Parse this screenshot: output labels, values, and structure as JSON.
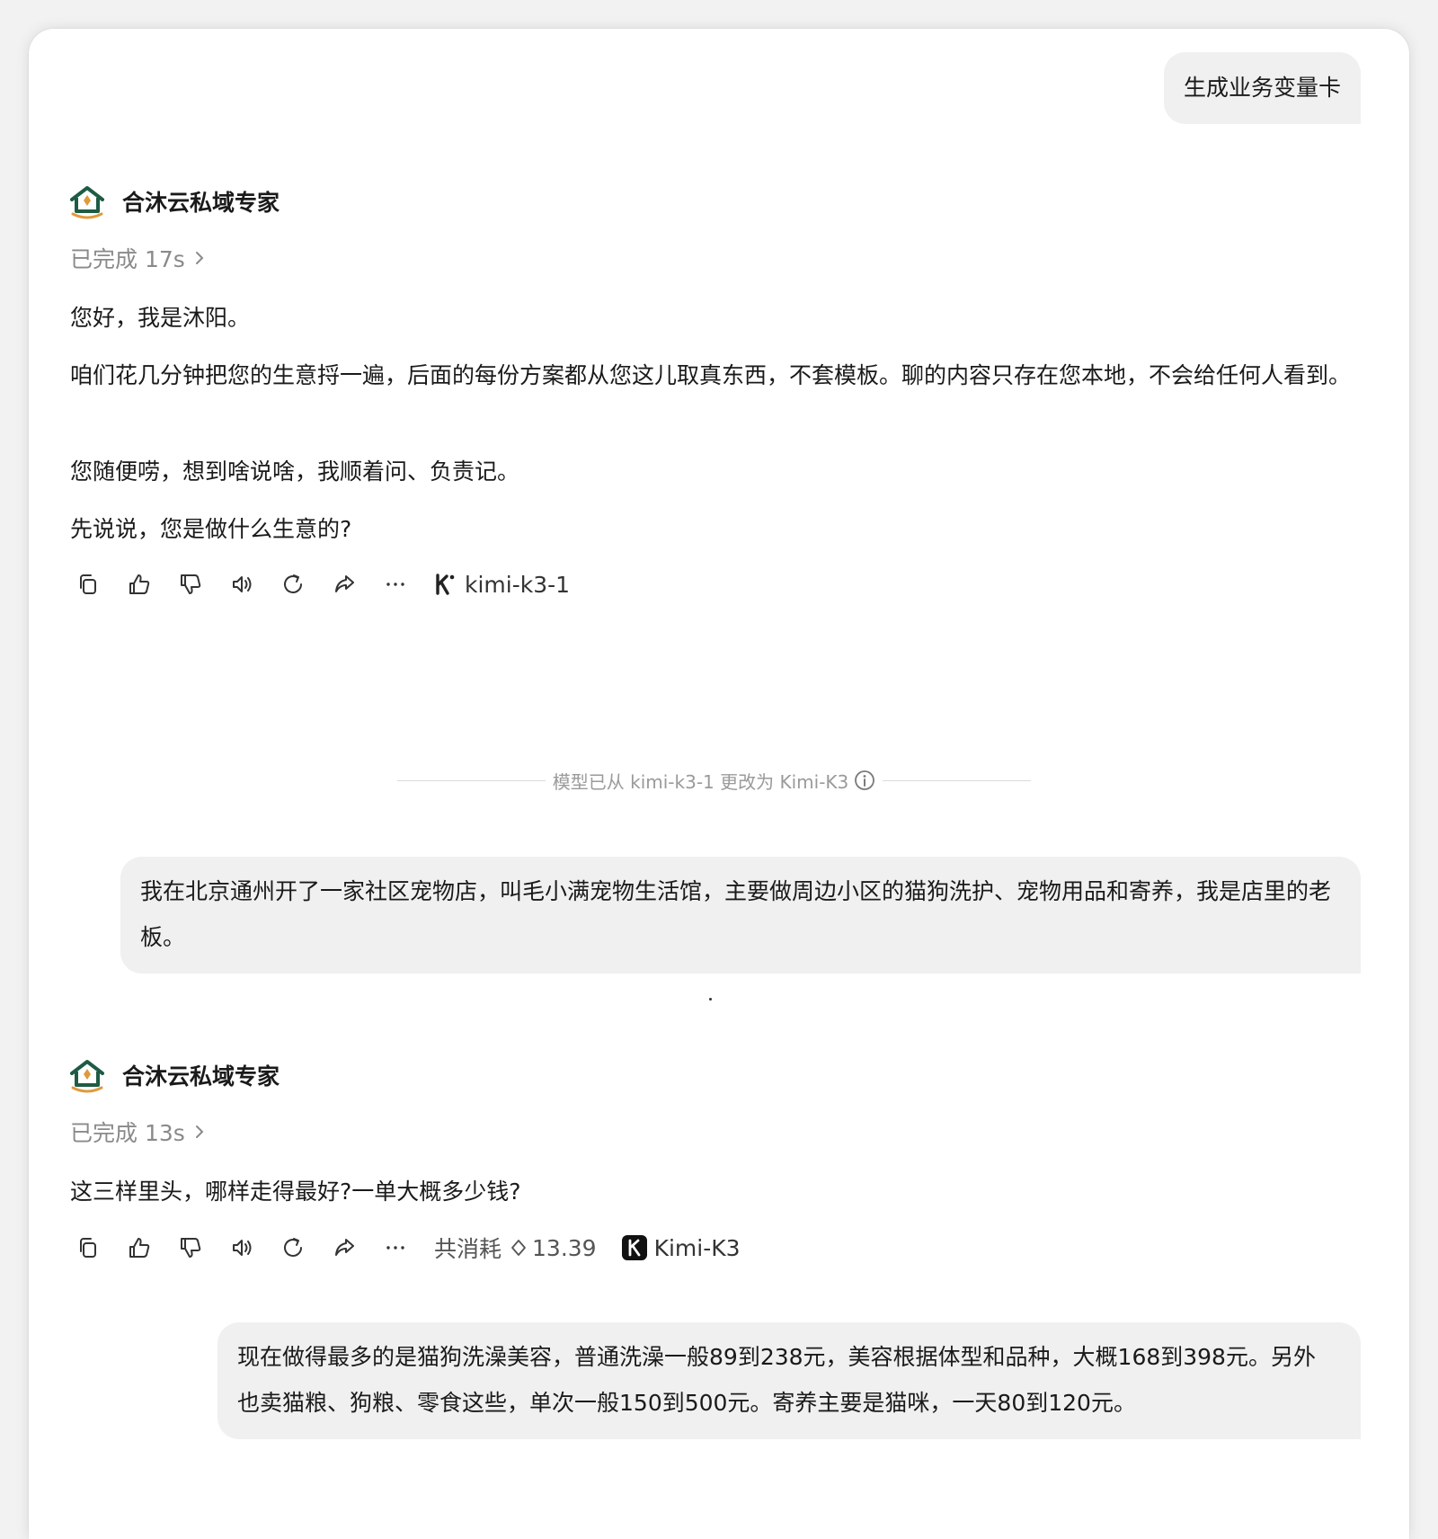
{
  "messages": [
    {
      "role": "user",
      "text": "生成业务变量卡"
    },
    {
      "role": "assistant",
      "agent_name": "合沐云私域专家",
      "status": "已完成 17s",
      "paragraphs": [
        "您好，我是沐阳。",
        "咱们花几分钟把您的生意捋一遍，后面的每份方案都从您这儿取真东西，不套模板。聊的内容只存在您本地，不会给任何人看到。",
        "您随便唠，想到啥说啥，我顺着问、负责记。",
        "先说说，您是做什么生意的?"
      ],
      "model": "kimi-k3-1"
    },
    {
      "role": "system",
      "text": "模型已从 kimi-k3-1 更改为 Kimi-K3"
    },
    {
      "role": "user",
      "text": "我在北京通州开了一家社区宠物店，叫毛小满宠物生活馆，主要做周边小区的猫狗洗护、宠物用品和寄养，我是店里的老板。"
    },
    {
      "role": "assistant",
      "agent_name": "合沐云私域专家",
      "status": "已完成 13s",
      "paragraphs": [
        "这三样里头，哪样走得最好?一单大概多少钱?"
      ],
      "cost_label": "共消耗",
      "cost_value": "13.39",
      "model": "Kimi-K3"
    },
    {
      "role": "user",
      "text": "现在做得最多的是猫狗洗澡美容，普通洗澡一般89到238元，美容根据体型和品种，大概168到398元。另外也卖猫粮、狗粮、零食这些，单次一般150到500元。寄养主要是猫咪，一天80到120元。"
    }
  ],
  "toolbar_actions": [
    "copy-icon",
    "thumbs-up-icon",
    "thumbs-down-icon",
    "speaker-icon",
    "regenerate-icon",
    "share-icon",
    "more-icon"
  ],
  "colors": {
    "bubble_bg": "#f0f0f0",
    "logo_green": "#1e5b45",
    "logo_orange": "#e09a3c",
    "muted_text": "#8a8a8a"
  }
}
